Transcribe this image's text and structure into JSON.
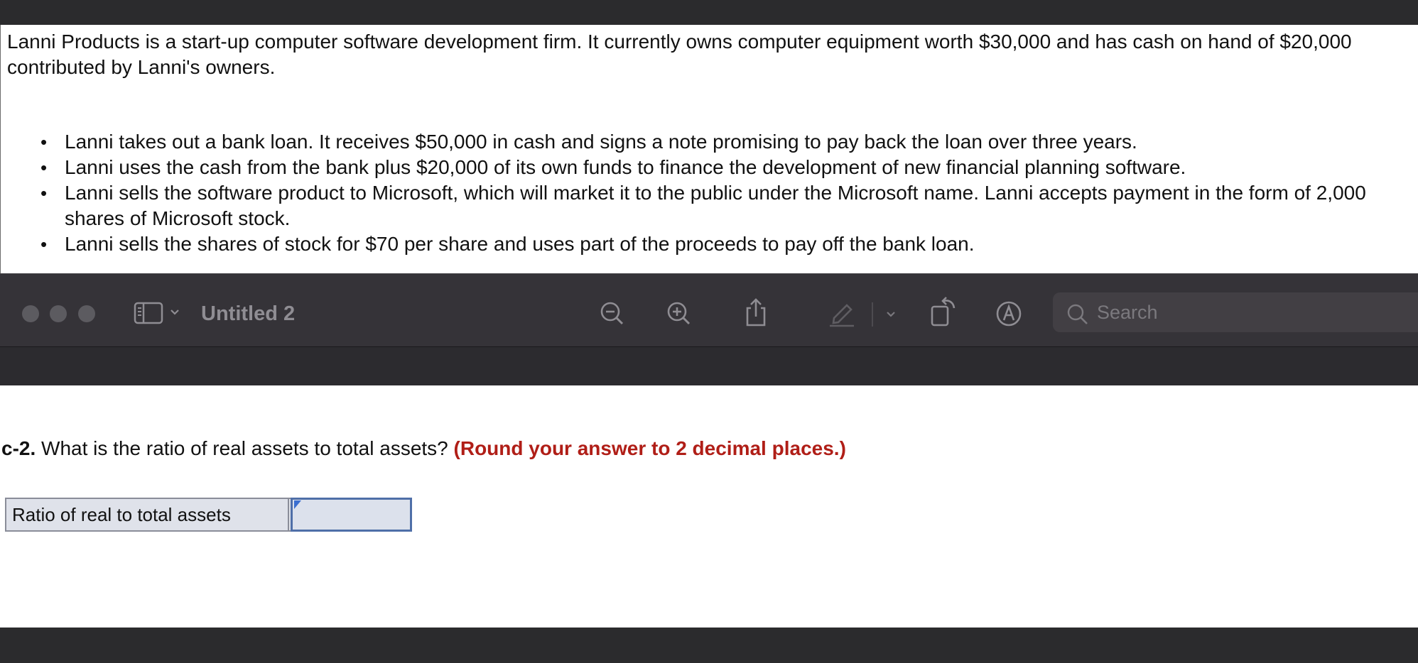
{
  "problem": {
    "intro": "Lanni Products is a start-up computer software development firm. It currently owns computer equipment worth $30,000 and has cash on hand of $20,000 contributed by Lanni's owners.",
    "bullets": [
      "Lanni takes out a bank loan. It receives $50,000 in cash and signs a note promising to pay back the loan over three years.",
      "Lanni uses the cash from the bank plus $20,000 of its own funds to finance the development of new financial planning software.",
      "Lanni sells the software product to Microsoft, which will market it to the public under the Microsoft name. Lanni accepts payment in the form of 2,000 shares of Microsoft stock.",
      "Lanni sells the shares of stock for $70 per share and uses part of the proceeds to pay off the bank loan."
    ]
  },
  "preview_window": {
    "title": "Untitled 2",
    "search_placeholder": "Search",
    "icons": [
      "sidebar-toggle-icon",
      "chevron-down-icon",
      "zoom-out-icon",
      "zoom-in-icon",
      "share-icon",
      "highlight-pen-icon",
      "chevron-down-icon",
      "rotate-icon",
      "markup-icon",
      "search-icon"
    ]
  },
  "question": {
    "number": "c-2.",
    "text": " What is the ratio of real assets to total assets? ",
    "hint": "(Round your answer to 2 decimal places.)"
  },
  "answer_table": {
    "label": "Ratio of real to total assets",
    "value": ""
  },
  "colors": {
    "hint_red": "#b01e17",
    "input_border": "#4f6fa8",
    "toolbar_bg": "#353338"
  }
}
